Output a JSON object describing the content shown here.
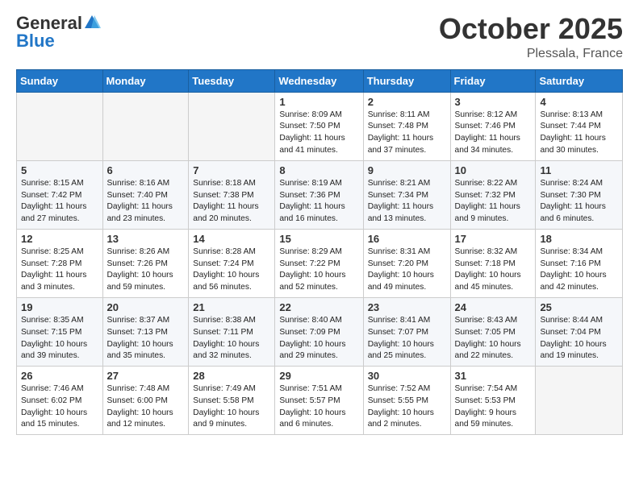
{
  "logo": {
    "general": "General",
    "blue": "Blue"
  },
  "title": "October 2025",
  "location": "Plessala, France",
  "weekdays": [
    "Sunday",
    "Monday",
    "Tuesday",
    "Wednesday",
    "Thursday",
    "Friday",
    "Saturday"
  ],
  "weeks": [
    [
      {
        "day": "",
        "info": ""
      },
      {
        "day": "",
        "info": ""
      },
      {
        "day": "",
        "info": ""
      },
      {
        "day": "1",
        "info": "Sunrise: 8:09 AM\nSunset: 7:50 PM\nDaylight: 11 hours\nand 41 minutes."
      },
      {
        "day": "2",
        "info": "Sunrise: 8:11 AM\nSunset: 7:48 PM\nDaylight: 11 hours\nand 37 minutes."
      },
      {
        "day": "3",
        "info": "Sunrise: 8:12 AM\nSunset: 7:46 PM\nDaylight: 11 hours\nand 34 minutes."
      },
      {
        "day": "4",
        "info": "Sunrise: 8:13 AM\nSunset: 7:44 PM\nDaylight: 11 hours\nand 30 minutes."
      }
    ],
    [
      {
        "day": "5",
        "info": "Sunrise: 8:15 AM\nSunset: 7:42 PM\nDaylight: 11 hours\nand 27 minutes."
      },
      {
        "day": "6",
        "info": "Sunrise: 8:16 AM\nSunset: 7:40 PM\nDaylight: 11 hours\nand 23 minutes."
      },
      {
        "day": "7",
        "info": "Sunrise: 8:18 AM\nSunset: 7:38 PM\nDaylight: 11 hours\nand 20 minutes."
      },
      {
        "day": "8",
        "info": "Sunrise: 8:19 AM\nSunset: 7:36 PM\nDaylight: 11 hours\nand 16 minutes."
      },
      {
        "day": "9",
        "info": "Sunrise: 8:21 AM\nSunset: 7:34 PM\nDaylight: 11 hours\nand 13 minutes."
      },
      {
        "day": "10",
        "info": "Sunrise: 8:22 AM\nSunset: 7:32 PM\nDaylight: 11 hours\nand 9 minutes."
      },
      {
        "day": "11",
        "info": "Sunrise: 8:24 AM\nSunset: 7:30 PM\nDaylight: 11 hours\nand 6 minutes."
      }
    ],
    [
      {
        "day": "12",
        "info": "Sunrise: 8:25 AM\nSunset: 7:28 PM\nDaylight: 11 hours\nand 3 minutes."
      },
      {
        "day": "13",
        "info": "Sunrise: 8:26 AM\nSunset: 7:26 PM\nDaylight: 10 hours\nand 59 minutes."
      },
      {
        "day": "14",
        "info": "Sunrise: 8:28 AM\nSunset: 7:24 PM\nDaylight: 10 hours\nand 56 minutes."
      },
      {
        "day": "15",
        "info": "Sunrise: 8:29 AM\nSunset: 7:22 PM\nDaylight: 10 hours\nand 52 minutes."
      },
      {
        "day": "16",
        "info": "Sunrise: 8:31 AM\nSunset: 7:20 PM\nDaylight: 10 hours\nand 49 minutes."
      },
      {
        "day": "17",
        "info": "Sunrise: 8:32 AM\nSunset: 7:18 PM\nDaylight: 10 hours\nand 45 minutes."
      },
      {
        "day": "18",
        "info": "Sunrise: 8:34 AM\nSunset: 7:16 PM\nDaylight: 10 hours\nand 42 minutes."
      }
    ],
    [
      {
        "day": "19",
        "info": "Sunrise: 8:35 AM\nSunset: 7:15 PM\nDaylight: 10 hours\nand 39 minutes."
      },
      {
        "day": "20",
        "info": "Sunrise: 8:37 AM\nSunset: 7:13 PM\nDaylight: 10 hours\nand 35 minutes."
      },
      {
        "day": "21",
        "info": "Sunrise: 8:38 AM\nSunset: 7:11 PM\nDaylight: 10 hours\nand 32 minutes."
      },
      {
        "day": "22",
        "info": "Sunrise: 8:40 AM\nSunset: 7:09 PM\nDaylight: 10 hours\nand 29 minutes."
      },
      {
        "day": "23",
        "info": "Sunrise: 8:41 AM\nSunset: 7:07 PM\nDaylight: 10 hours\nand 25 minutes."
      },
      {
        "day": "24",
        "info": "Sunrise: 8:43 AM\nSunset: 7:05 PM\nDaylight: 10 hours\nand 22 minutes."
      },
      {
        "day": "25",
        "info": "Sunrise: 8:44 AM\nSunset: 7:04 PM\nDaylight: 10 hours\nand 19 minutes."
      }
    ],
    [
      {
        "day": "26",
        "info": "Sunrise: 7:46 AM\nSunset: 6:02 PM\nDaylight: 10 hours\nand 15 minutes."
      },
      {
        "day": "27",
        "info": "Sunrise: 7:48 AM\nSunset: 6:00 PM\nDaylight: 10 hours\nand 12 minutes."
      },
      {
        "day": "28",
        "info": "Sunrise: 7:49 AM\nSunset: 5:58 PM\nDaylight: 10 hours\nand 9 minutes."
      },
      {
        "day": "29",
        "info": "Sunrise: 7:51 AM\nSunset: 5:57 PM\nDaylight: 10 hours\nand 6 minutes."
      },
      {
        "day": "30",
        "info": "Sunrise: 7:52 AM\nSunset: 5:55 PM\nDaylight: 10 hours\nand 2 minutes."
      },
      {
        "day": "31",
        "info": "Sunrise: 7:54 AM\nSunset: 5:53 PM\nDaylight: 9 hours\nand 59 minutes."
      },
      {
        "day": "",
        "info": ""
      }
    ]
  ]
}
